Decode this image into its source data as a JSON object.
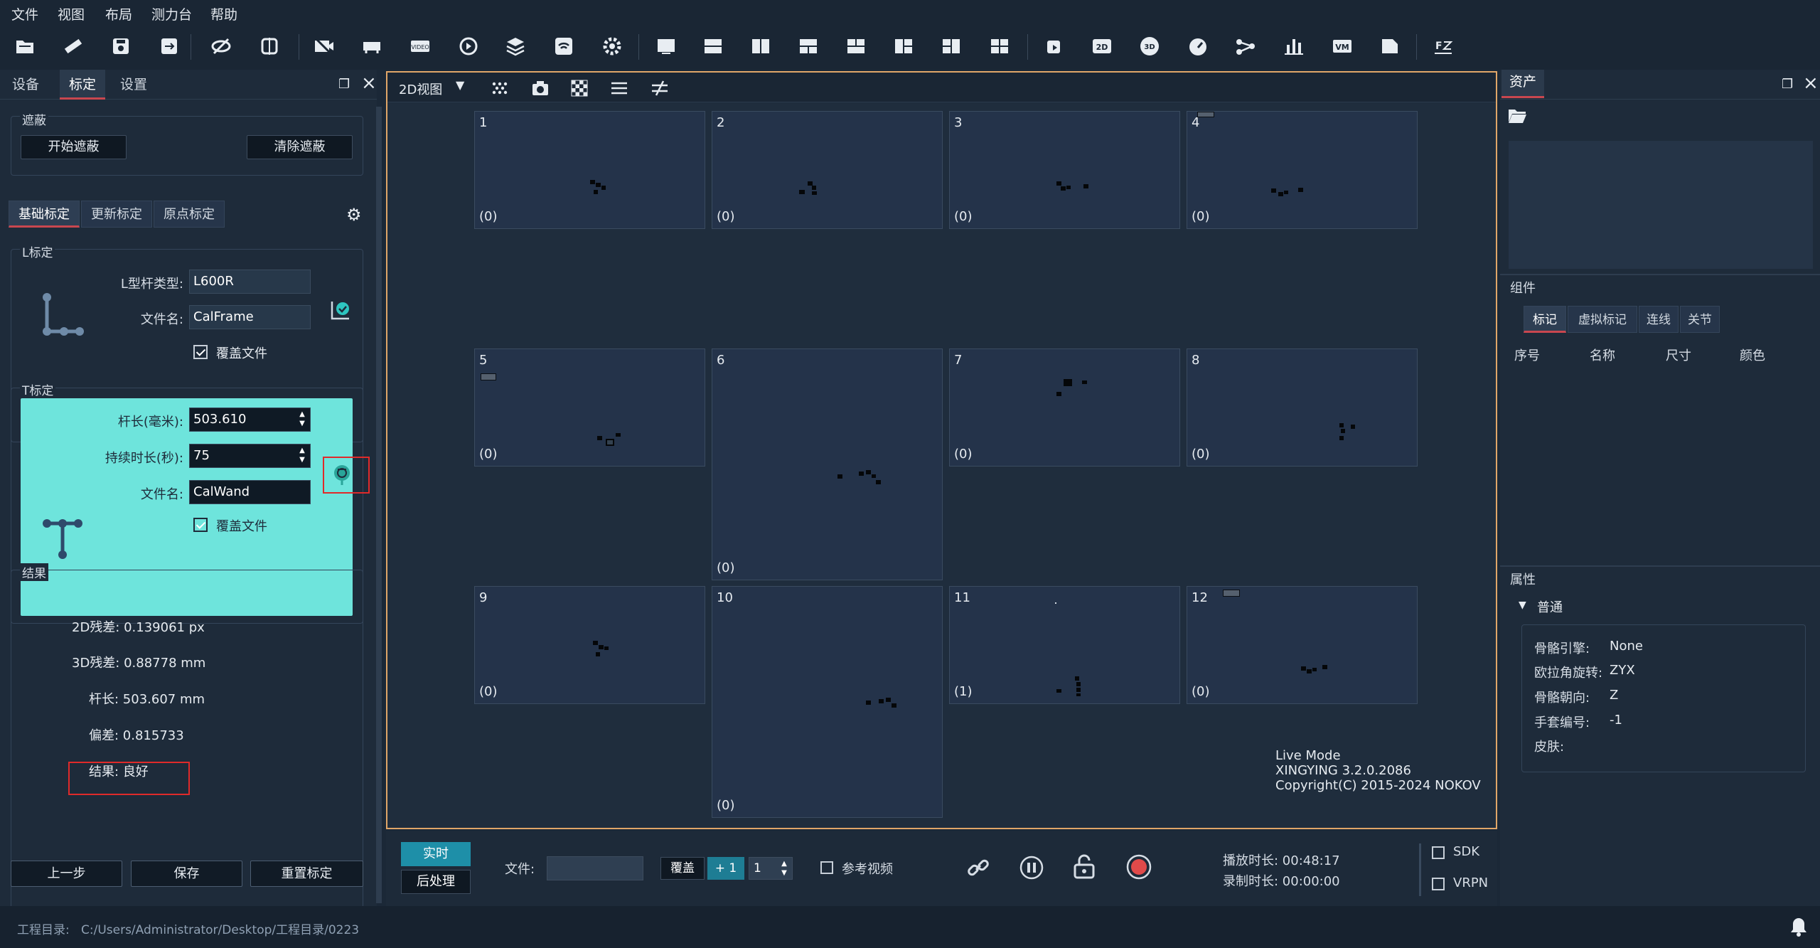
{
  "menu": [
    "文件",
    "视图",
    "布局",
    "测力台",
    "帮助"
  ],
  "toolbar_icons": [
    "open-folder-icon",
    "ruler-icon",
    "save-icon",
    "save-as-icon",
    "hide-icon",
    "mirror-icon",
    "video-off-icon",
    "device-icon",
    "video-icon",
    "refresh-icon",
    "layers-icon",
    "wifi-icon",
    "settings-icon",
    "layout-1-icon",
    "layout-2-icon",
    "layout-3-icon",
    "layout-4-icon",
    "layout-5-icon",
    "layout-6-icon",
    "layout-7-icon",
    "layout-8-icon",
    "rotate-icon",
    "2d-icon",
    "3d-icon",
    "gauge-icon",
    "share-icon",
    "bar-chart-icon",
    "vm-icon",
    "file-icon",
    "fz-icon"
  ],
  "left_panel": {
    "tabs": [
      "设备",
      "标定",
      "设置"
    ],
    "active_tab": "标定",
    "mask": {
      "title": "遮蔽",
      "start": "开始遮蔽",
      "clear": "清除遮蔽"
    },
    "cal_tabs": [
      "基础标定",
      "更新标定",
      "原点标定"
    ],
    "l_cal": {
      "title": "L标定",
      "type_label": "L型杆类型:",
      "type_value": "L600R",
      "file_label": "文件名:",
      "file_value": "CalFrame",
      "overwrite": "覆盖文件"
    },
    "t_cal": {
      "title": "T标定",
      "length_label": "杆长(毫米):",
      "length_value": "503.610",
      "duration_label": "持续时长(秒):",
      "duration_value": "75",
      "file_label": "文件名:",
      "file_value": "CalWand",
      "overwrite": "覆盖文件"
    },
    "result": {
      "title": "结果",
      "r2d": "2D残差:  0.139061 px",
      "r3d": "3D残差:  0.88778 mm",
      "len": "杆长:  503.607 mm",
      "dev": "偏差:  0.815733",
      "res": "结果:  良好"
    },
    "buttons": {
      "prev": "上一步",
      "save": "保存",
      "reset": "重置标定"
    }
  },
  "view": {
    "mode": "2D视图",
    "cameras": [
      {
        "num": "1",
        "count": "(0)"
      },
      {
        "num": "2",
        "count": "(0)"
      },
      {
        "num": "3",
        "count": "(0)"
      },
      {
        "num": "4",
        "count": "(0)"
      },
      {
        "num": "5",
        "count": "(0)"
      },
      {
        "num": "6",
        "count": "(0)"
      },
      {
        "num": "7",
        "count": "(0)"
      },
      {
        "num": "8",
        "count": "(0)"
      },
      {
        "num": "9",
        "count": "(0)"
      },
      {
        "num": "10",
        "count": "(0)"
      },
      {
        "num": "11",
        "count": "(1)"
      },
      {
        "num": "12",
        "count": "(0)"
      }
    ],
    "info_line1": "Live Mode",
    "info_line2": "XINGYING 3.2.0.2086",
    "info_line3": "Copyright(C) 2015-2024 NOKOV"
  },
  "bottom": {
    "live": "实时",
    "post": "后处理",
    "file_label": "文件:",
    "file_value": "",
    "overwrite": "覆盖",
    "plus": "+ 1",
    "step_value": "1",
    "ref_video": "参考视频",
    "play_time": "播放时长:  00:48:17",
    "rec_time": "录制时长:  00:00:00",
    "sdk": "SDK",
    "vrpn": "VRPN"
  },
  "right_panel": {
    "tab": "资产",
    "components": "组件",
    "comp_tabs": [
      "标记",
      "虚拟标记",
      "连线",
      "关节"
    ],
    "columns": [
      "序号",
      "名称",
      "尺寸",
      "颜色"
    ],
    "props": "属性",
    "normal": "普通",
    "rows": [
      {
        "label": "骨骼引擎:",
        "value": "None"
      },
      {
        "label": "欧拉角旋转:",
        "value": "ZYX"
      },
      {
        "label": "骨骼朝向:",
        "value": "Z"
      },
      {
        "label": "手套编号:",
        "value": "-1"
      },
      {
        "label": "皮肤:",
        "value": ""
      }
    ]
  },
  "status": {
    "label": "工程目录:",
    "path": "C:/Users/Administrator/Desktop/工程目录/0223"
  },
  "colors": {
    "accent_red": "#c9474f",
    "teal_panel": "#6ee4dc",
    "view_border": "#e0a668",
    "live_btn": "#1e8fa8"
  }
}
